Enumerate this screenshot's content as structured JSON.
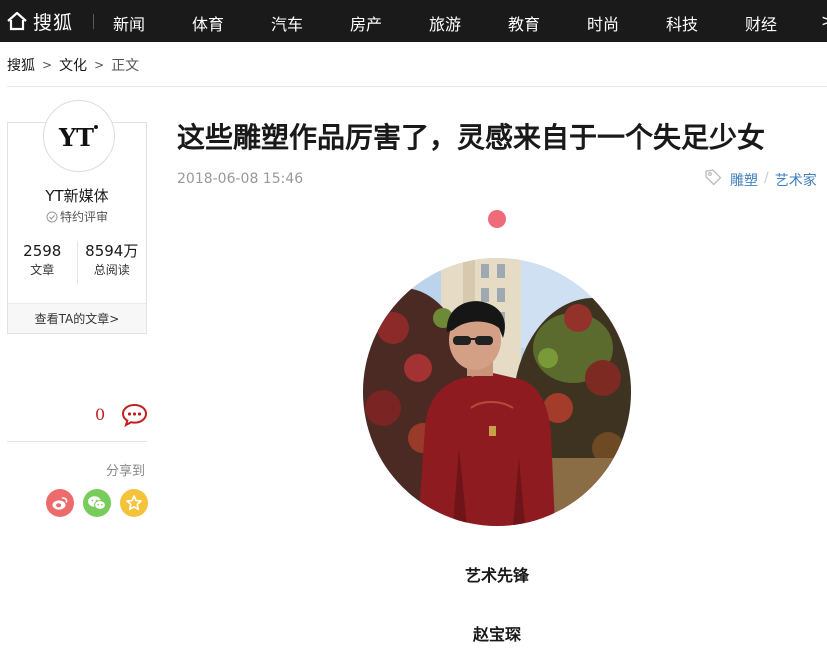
{
  "nav": {
    "logo_text": "搜狐",
    "items": [
      "新闻",
      "体育",
      "汽车",
      "房产",
      "旅游",
      "教育",
      "时尚",
      "科技",
      "财经"
    ]
  },
  "breadcrumb": {
    "home": "搜狐",
    "section": "文化",
    "current": "正文",
    "separator": ">"
  },
  "author": {
    "avatar_text": "YT",
    "name": "YT新媒体",
    "badge": "特约评审",
    "articles_count": "2598",
    "articles_label": "文章",
    "reads_count": "8594万",
    "reads_label": "总阅读",
    "link_label": "查看TA的文章>"
  },
  "side": {
    "comment_count": "0",
    "share_label": "分享到"
  },
  "article": {
    "title": "这些雕塑作品厉害了，灵感来自于一个失足少女",
    "time": "2018-06-08 15:46",
    "tags": [
      "雕塑",
      "艺术家"
    ],
    "tag_separator": "/",
    "caption_1": "艺术先锋",
    "caption_2": "赵宝琛"
  },
  "colors": {
    "nav_bg": "#1a1a1a",
    "tag_link": "#3f7fbf",
    "accent_dot": "#ef6b7a",
    "comment_count": "#c41f1f",
    "weibo": "#ee6b6d",
    "wechat": "#77cc5a",
    "favorite": "#f5c33a"
  },
  "icons": [
    "home-icon",
    "verified-icon",
    "comment-icon",
    "weibo-icon",
    "wechat-icon",
    "star-icon",
    "tag-icon"
  ]
}
